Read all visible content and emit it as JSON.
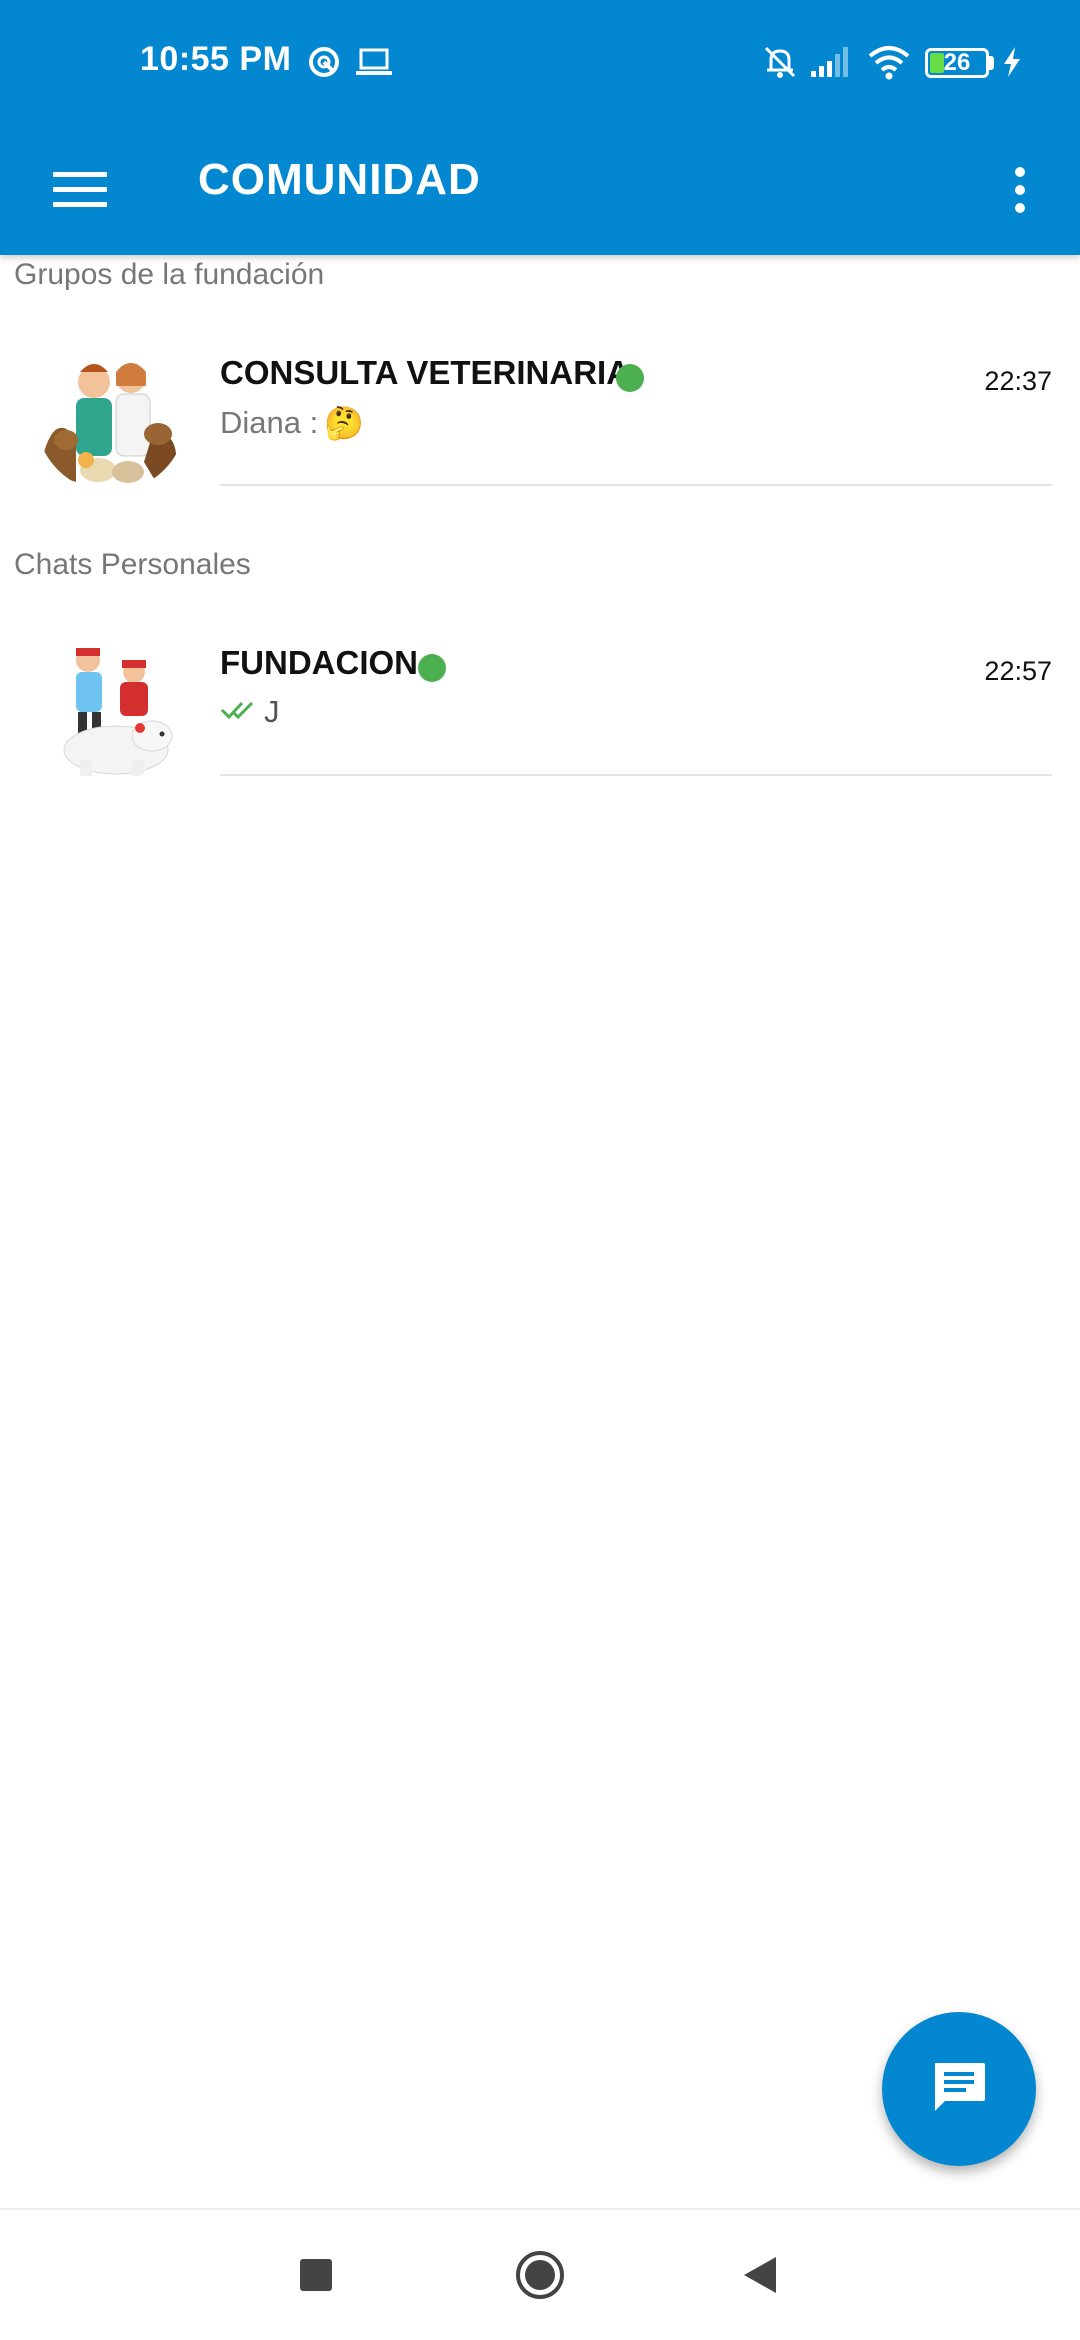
{
  "status_bar": {
    "time": "10:55 PM",
    "battery_level": "26",
    "icons": [
      "do-not-disturb-icon",
      "laptop-icon",
      "mute-bell-icon",
      "signal-icon",
      "wifi-icon",
      "battery-icon",
      "charging-icon"
    ]
  },
  "app_bar": {
    "title": "COMUNIDAD",
    "menu_icon": "hamburger-menu-icon",
    "more_icon": "more-vertical-icon"
  },
  "sections": [
    {
      "header": "Grupos de la fundación",
      "chats": [
        {
          "name": "CONSULTA VETERINARIA",
          "online": true,
          "time": "22:37",
          "preview_sender": "Diana :",
          "preview_emoji": "🤔"
        }
      ]
    },
    {
      "header": "Chats Personales",
      "chats": [
        {
          "name": "FUNDACION",
          "online": true,
          "time": "22:57",
          "preview_text": "J",
          "preview_status": "double-check-icon"
        }
      ]
    }
  ],
  "fab": {
    "icon": "new-message-icon"
  },
  "nav_bar": {
    "buttons": [
      "recent-apps-button",
      "home-button",
      "back-button"
    ]
  },
  "colors": {
    "primary": "#0287d0",
    "online": "#4caf50",
    "read_check": "#4caf50"
  }
}
